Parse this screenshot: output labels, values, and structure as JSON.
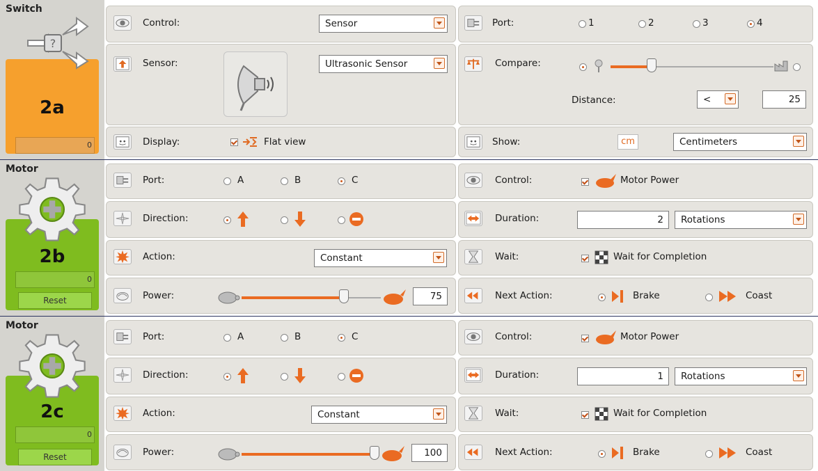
{
  "switch": {
    "title": "Switch",
    "code": "2a",
    "counter": "0",
    "control": {
      "label": "Control:",
      "value": "Sensor"
    },
    "sensor": {
      "label": "Sensor:",
      "value": "Ultrasonic Sensor"
    },
    "display": {
      "label": "Display:",
      "value": "Flat view"
    },
    "port": {
      "label": "Port:",
      "options": [
        "1",
        "2",
        "3",
        "4"
      ],
      "selected": "4"
    },
    "compare": {
      "label": "Compare:",
      "slider_fraction": 0.2,
      "distance_label": "Distance:",
      "operator": "<",
      "value": "25"
    },
    "show": {
      "label": "Show:",
      "unit_icon": "cm",
      "value": "Centimeters"
    }
  },
  "motor1": {
    "title": "Motor",
    "code": "2b",
    "counter": "0",
    "reset": "Reset",
    "port": {
      "label": "Port:",
      "options": [
        "A",
        "B",
        "C"
      ],
      "selected": "C"
    },
    "direction": {
      "label": "Direction:",
      "selected": "forward"
    },
    "action": {
      "label": "Action:",
      "value": "Constant"
    },
    "power": {
      "label": "Power:",
      "value": "75"
    },
    "control": {
      "label": "Control:",
      "value": "Motor Power"
    },
    "duration": {
      "label": "Duration:",
      "value": "2",
      "unit": "Rotations"
    },
    "wait": {
      "label": "Wait:",
      "value": "Wait for Completion"
    },
    "next_action": {
      "label": "Next Action:",
      "options": [
        "Brake",
        "Coast"
      ],
      "selected": "Brake"
    }
  },
  "motor2": {
    "title": "Motor",
    "code": "2c",
    "counter": "0",
    "reset": "Reset",
    "port": {
      "label": "Port:",
      "options": [
        "A",
        "B",
        "C"
      ],
      "selected": "C"
    },
    "direction": {
      "label": "Direction:",
      "selected": "forward"
    },
    "action": {
      "label": "Action:",
      "value": "Constant"
    },
    "power": {
      "label": "Power:",
      "value": "100"
    },
    "control": {
      "label": "Control:",
      "value": "Motor Power"
    },
    "duration": {
      "label": "Duration:",
      "value": "1",
      "unit": "Rotations"
    },
    "wait": {
      "label": "Wait:",
      "value": "Wait for Completion"
    },
    "next_action": {
      "label": "Next Action:",
      "options": [
        "Brake",
        "Coast"
      ],
      "selected": "Brake"
    }
  },
  "colors": {
    "switch_accent": "#f6a02d",
    "motor_accent": "#7fbc1f",
    "slider_fill": "#ea6b22"
  }
}
